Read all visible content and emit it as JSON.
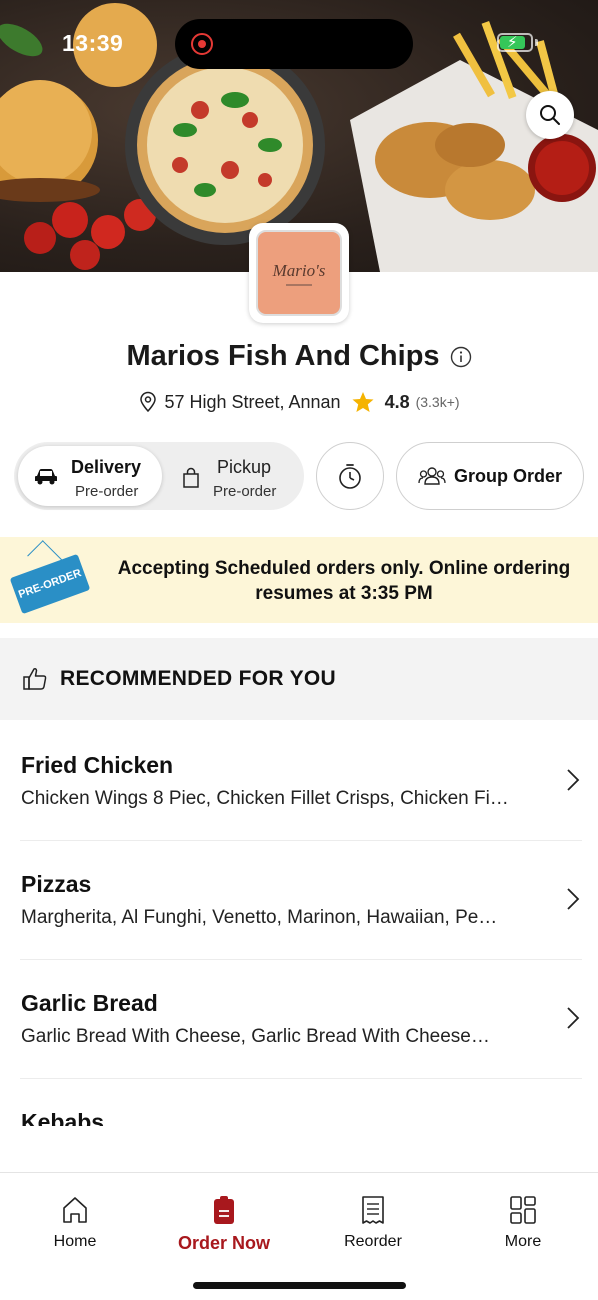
{
  "status_bar": {
    "time": "13:39",
    "battery_level": 0.85
  },
  "restaurant": {
    "logo_text": "Mario's",
    "name": "Marios Fish And Chips",
    "address": "57 High Street, Annan",
    "rating": "4.8",
    "reviews": "(3.3k+)"
  },
  "order_mode": {
    "selected": "Delivery",
    "delivery": {
      "label": "Delivery",
      "sub": "Pre-order"
    },
    "pickup": {
      "label": "Pickup",
      "sub": "Pre-order"
    },
    "group_order_label": "Group Order"
  },
  "banner": {
    "tag": "PRE-ORDER",
    "message": "Accepting Scheduled orders only. Online ordering resumes at 3:35 PM"
  },
  "section": {
    "title": "RECOMMENDED FOR YOU"
  },
  "categories": [
    {
      "name": "Fried Chicken",
      "items": "Chicken Wings 8 Piec, Chicken Fillet Crisps, Chicken Fi…"
    },
    {
      "name": "Pizzas",
      "items": "Margherita, Al Funghi, Venetto, Marinon, Hawaiian, Pe…"
    },
    {
      "name": "Garlic Bread",
      "items": "Garlic Bread With Cheese, Garlic Bread With Cheese…"
    },
    {
      "name": "Kebabs",
      "items": ""
    }
  ],
  "tab_bar": {
    "active": "Order Now",
    "tabs": [
      {
        "label": "Home",
        "icon": "home-icon"
      },
      {
        "label": "Order Now",
        "icon": "order-icon"
      },
      {
        "label": "Reorder",
        "icon": "receipt-icon"
      },
      {
        "label": "More",
        "icon": "grid-icon"
      }
    ]
  },
  "colors": {
    "accent": "#a8181d",
    "banner_bg": "#fdf6d8",
    "star": "#f5b301",
    "preorder_tag": "#2a8fc6"
  }
}
